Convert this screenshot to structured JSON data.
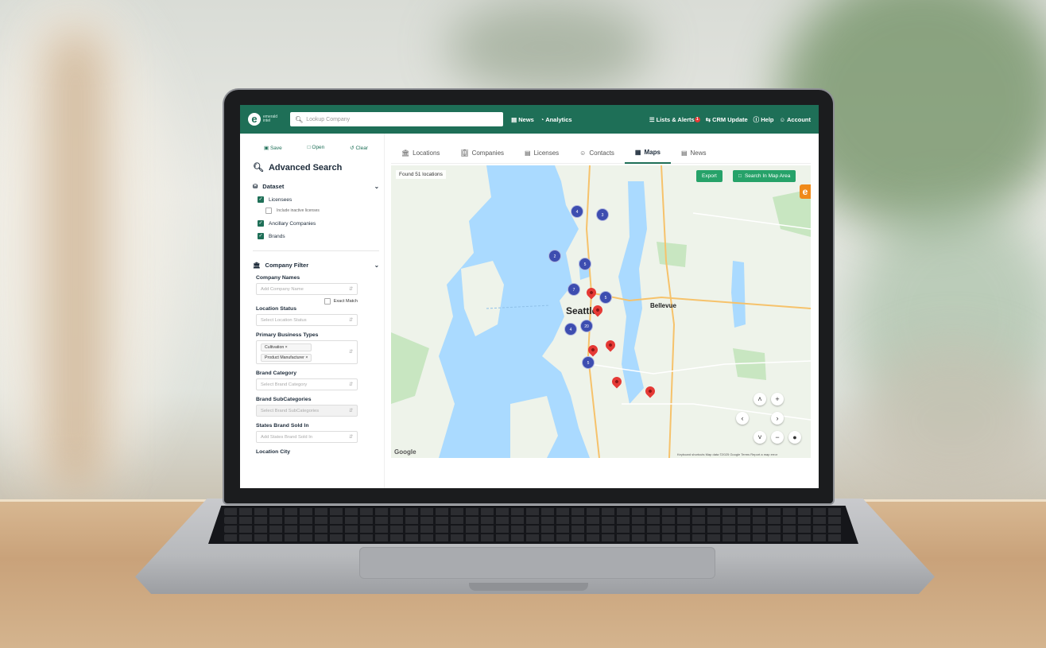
{
  "app": {
    "logo_line1": "emerald",
    "logo_line2": "intel",
    "search_placeholder": "Lookup Company"
  },
  "topnav": {
    "left": [
      {
        "icon": "news-icon",
        "label": "News"
      },
      {
        "icon": "analytics-icon",
        "label": "Analytics"
      }
    ],
    "right": [
      {
        "icon": "list-icon",
        "label": "Lists & Alerts",
        "badge": "1"
      },
      {
        "icon": "crm-update-icon",
        "label": "CRM Update"
      },
      {
        "icon": "help-icon",
        "label": "Help"
      },
      {
        "icon": "account-icon",
        "label": "Account"
      }
    ]
  },
  "sidebar": {
    "actions": {
      "save": "Save",
      "open": "Open",
      "clear": "Clear"
    },
    "title": "Advanced Search",
    "dataset": {
      "heading": "Dataset",
      "items": [
        {
          "label": "Licensees",
          "checked": true
        },
        {
          "label": "Include inactive licenses",
          "checked": false
        },
        {
          "label": "Ancillary Companies",
          "checked": true
        },
        {
          "label": "Brands",
          "checked": true
        }
      ]
    },
    "company_filter": {
      "heading": "Company Filter",
      "company_names_label": "Company Names",
      "company_names_placeholder": "Add Company Name",
      "exact_match": "Exact Match",
      "location_status_label": "Location Status",
      "location_status_placeholder": "Select Location Status",
      "business_types_label": "Primary Business Types",
      "business_types_tags": [
        "Cultivation",
        "Product Manufacturer"
      ],
      "brand_category_label": "Brand Category",
      "brand_category_placeholder": "Select Brand Category",
      "brand_subcategories_label": "Brand SubCategories",
      "brand_subcategories_placeholder": "Select Brand SubCategories",
      "states_label": "States Brand Sold In",
      "states_placeholder": "Add States Brand Sold In",
      "location_city_label": "Location City"
    }
  },
  "tabs": [
    {
      "icon": "building-icon",
      "label": "Locations",
      "active": false
    },
    {
      "icon": "company-icon",
      "label": "Companies",
      "active": false
    },
    {
      "icon": "license-icon",
      "label": "Licenses",
      "active": false
    },
    {
      "icon": "contacts-icon",
      "label": "Contacts",
      "active": false
    },
    {
      "icon": "map-icon",
      "label": "Maps",
      "active": true
    },
    {
      "icon": "news-icon",
      "label": "News",
      "active": false
    }
  ],
  "map": {
    "found_text": "Found 51 locations",
    "export_label": "Export",
    "search_area_label": "Search In Map Area",
    "city_main": "Seattle",
    "city_bellevue": "Bellevue",
    "attribution": "Keyboard shortcuts   Map data ©2025 Google   Terms   Report a map error",
    "google_logo": "Google",
    "clusters": [
      "4",
      "3",
      "2",
      "5",
      "7",
      "5",
      "4",
      "20",
      "5"
    ],
    "colors": {
      "water": "#aadaff",
      "land": "#eef3ea",
      "park": "#c8e6c1",
      "cluster": "#3d4db0",
      "pin": "#e53935",
      "brand": "#1e6f57",
      "accent_button": "#26a269"
    }
  }
}
